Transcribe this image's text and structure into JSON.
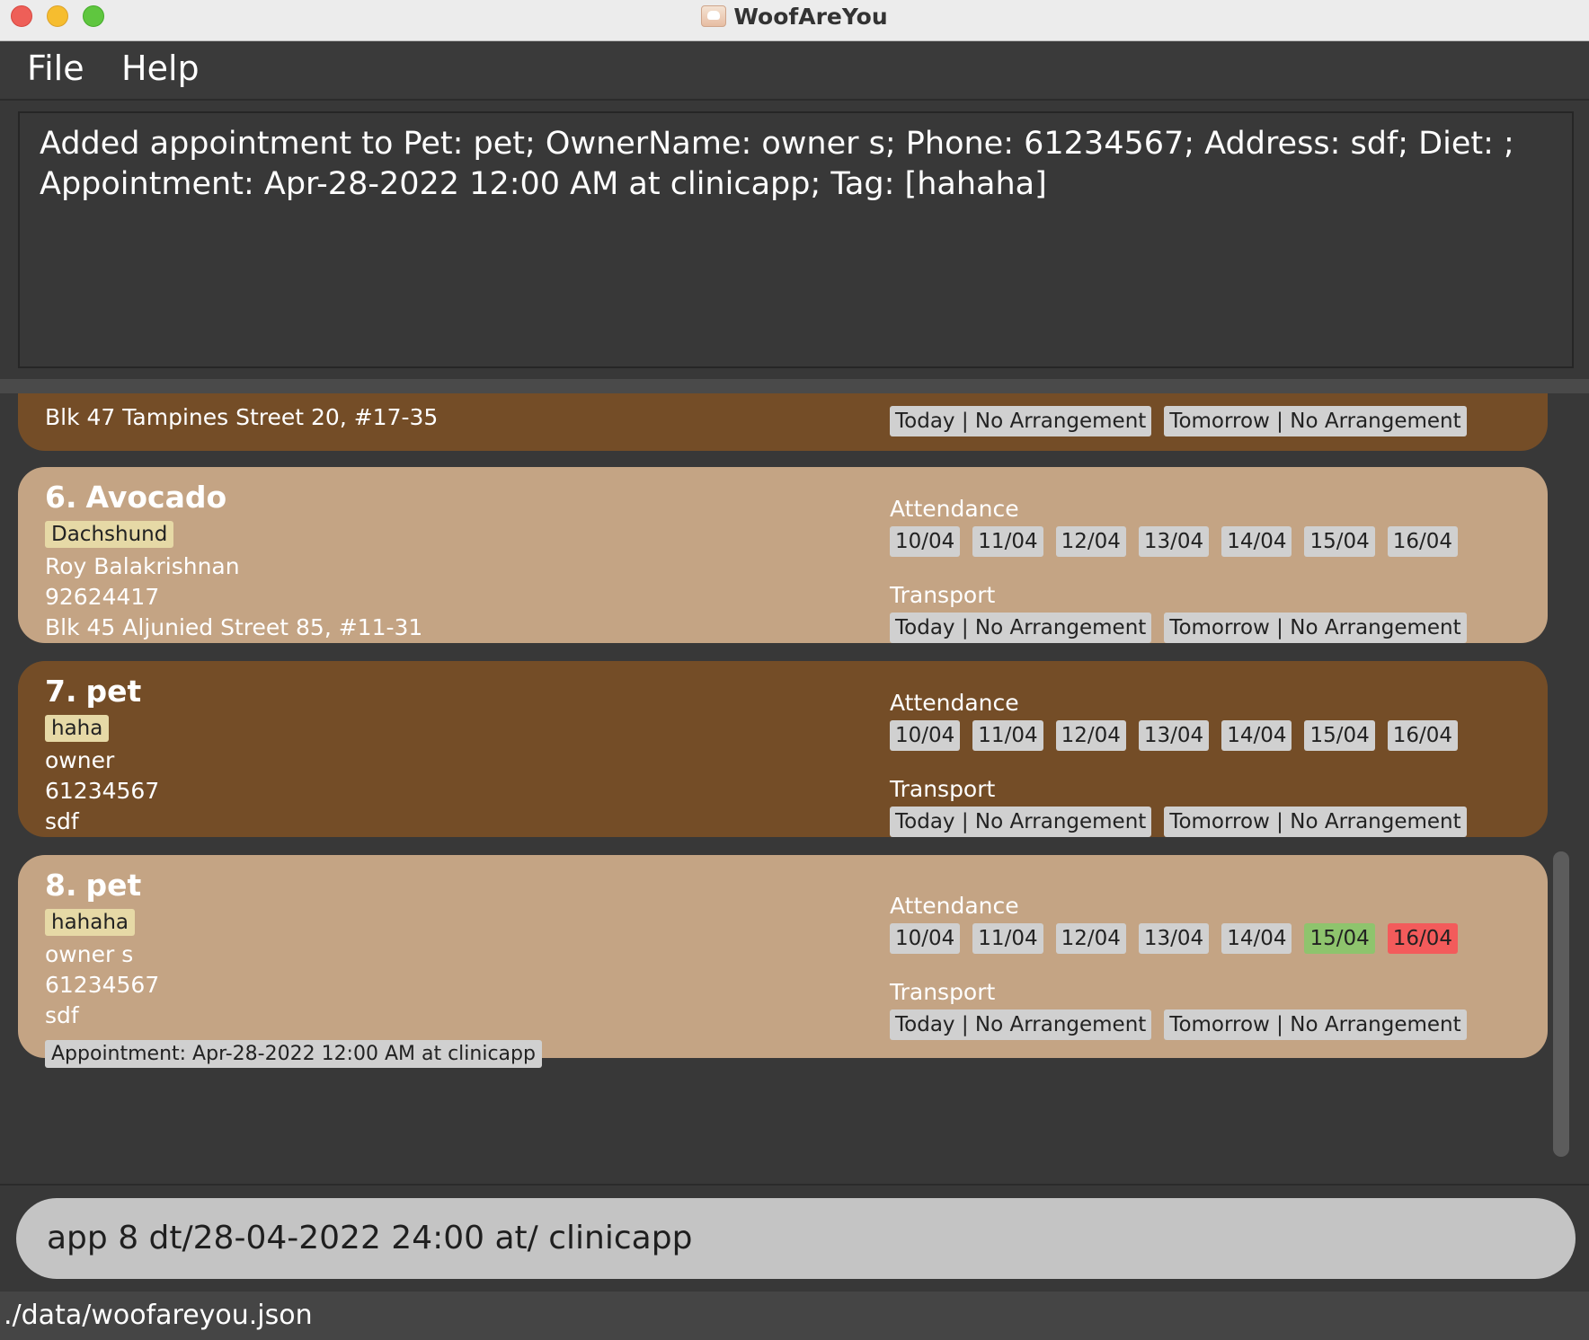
{
  "window": {
    "title": "WoofAreYou"
  },
  "menu": {
    "file": "File",
    "help": "Help"
  },
  "result": {
    "text": "Added appointment to Pet: pet; OwnerName: owner s; Phone: 61234567; Address: sdf; Diet: ; Appointment: Apr-28-2022 12:00 AM at clinicapp; Tag: [hahaha]"
  },
  "partial_card": {
    "address": "Blk 47 Tampines Street 20, #17-35",
    "transport": [
      "Today | No Arrangement",
      "Tomorrow | No Arrangement"
    ]
  },
  "pets": [
    {
      "index": "6.",
      "name": "Avocado",
      "tag": "Dachshund",
      "owner": "Roy Balakrishnan",
      "phone": "92624417",
      "address": "Blk 45 Aljunied Street 85, #11-31",
      "appointment": "",
      "attendance_label": "Attendance",
      "attendance": [
        "10/04",
        "11/04",
        "12/04",
        "13/04",
        "14/04",
        "15/04",
        "16/04"
      ],
      "transport_label": "Transport",
      "transport": [
        "Today | No Arrangement",
        "Tomorrow | No Arrangement"
      ]
    },
    {
      "index": "7.",
      "name": "pet",
      "tag": "haha",
      "owner": "owner",
      "phone": "61234567",
      "address": "sdf",
      "appointment": "",
      "attendance_label": "Attendance",
      "attendance": [
        "10/04",
        "11/04",
        "12/04",
        "13/04",
        "14/04",
        "15/04",
        "16/04"
      ],
      "transport_label": "Transport",
      "transport": [
        "Today | No Arrangement",
        "Tomorrow | No Arrangement"
      ]
    },
    {
      "index": "8.",
      "name": "pet",
      "tag": "hahaha",
      "owner": "owner s",
      "phone": "61234567",
      "address": "sdf",
      "appointment": "Appointment: Apr-28-2022 12:00 AM at clinicapp",
      "attendance_label": "Attendance",
      "attendance": [
        "10/04",
        "11/04",
        "12/04",
        "13/04",
        "14/04",
        "15/04",
        "16/04"
      ],
      "attendance_status": {
        "15/04": "present",
        "16/04": "absent"
      },
      "transport_label": "Transport",
      "transport": [
        "Today | No Arrangement",
        "Tomorrow | No Arrangement"
      ]
    }
  ],
  "colors": {
    "card_dark": "#744d27",
    "card_light": "#c4a484",
    "present": "#8ec46d",
    "absent": "#f35b5b"
  },
  "command": {
    "value": "app 8 dt/28-04-2022 24:00 at/ clinicapp"
  },
  "status": {
    "path": "./data/woofareyou.json"
  }
}
